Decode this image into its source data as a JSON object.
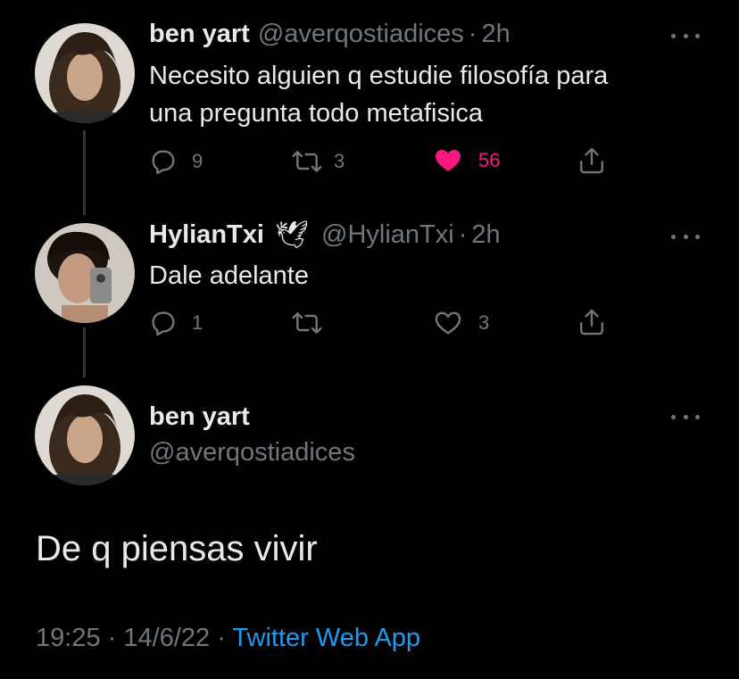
{
  "colors": {
    "background": "#000000",
    "primary_text": "#e7e9ea",
    "secondary_text": "#71767b",
    "like_pink": "#f91880",
    "link_blue": "#1d9bf0",
    "thread_line": "#333639"
  },
  "replies": [
    {
      "author_name": "ben yart",
      "handle": "@averqostiadices",
      "separator": "·",
      "time": "2h",
      "text_lines": [
        "Necesito alguien q estudie filosofía para",
        "una pregunta todo metafisica"
      ],
      "replies_count": "9",
      "retweets_count": "3",
      "likes_count": "56",
      "liked": true,
      "more_icon": "more-horizontal-icon"
    },
    {
      "author_name": "HylianTxi",
      "name_emoji": "🕊",
      "handle": "@HylianTxi",
      "separator": "·",
      "time": "2h",
      "text_lines": [
        "Dale adelante"
      ],
      "replies_count": "1",
      "retweets_count": "",
      "likes_count": "3",
      "liked": false,
      "more_icon": "more-horizontal-icon"
    }
  ],
  "main_tweet": {
    "author_name": "ben yart",
    "handle": "@averqostiadices",
    "text": "De q piensas vivir",
    "time": "19:25",
    "separator": "·",
    "date": "14/6/22",
    "source": "Twitter Web App"
  }
}
